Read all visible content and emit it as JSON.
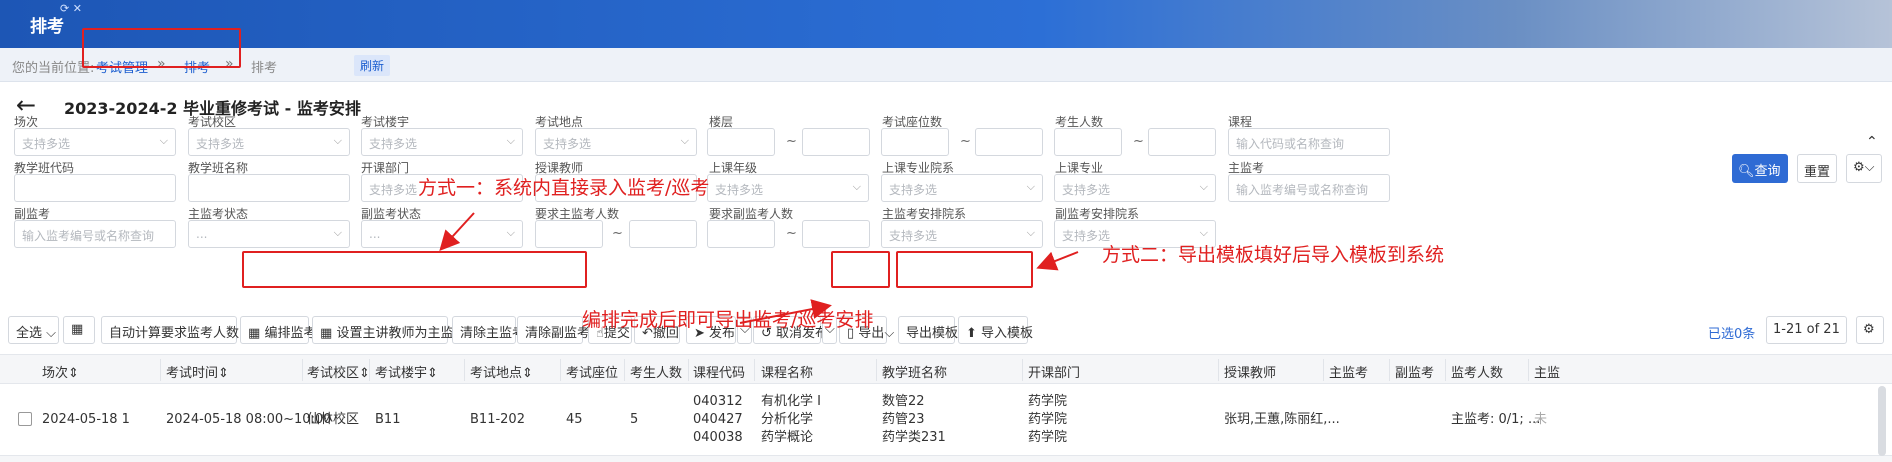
{
  "header": {
    "title": "排考",
    "tab_icons": "⟳ ✕"
  },
  "breadcrumb": {
    "prefix": "您的当前位置:",
    "items": [
      "考试管理",
      "排考",
      "排考"
    ],
    "separator": "»",
    "refresh": "刷新"
  },
  "page": {
    "back_arrow": "←",
    "title": "2023-2024-2 毕业重修考试 - 监考安排"
  },
  "filters": {
    "row1": [
      {
        "label": "场次",
        "placeholder": "支持多选"
      },
      {
        "label": "考试校区",
        "placeholder": "支持多选"
      },
      {
        "label": "考试楼宇",
        "placeholder": "支持多选"
      },
      {
        "label": "考试地点",
        "placeholder": "支持多选"
      },
      {
        "label": "楼层",
        "placeholder": ""
      },
      {
        "label": "考试座位数",
        "placeholder": ""
      },
      {
        "label": "考生人数",
        "placeholder": ""
      },
      {
        "label": "课程",
        "placeholder": "输入代码或名称查询"
      }
    ],
    "row2": [
      {
        "label": "教学班代码",
        "placeholder": ""
      },
      {
        "label": "教学班名称",
        "placeholder": ""
      },
      {
        "label": "开课部门",
        "placeholder": "支持多选"
      },
      {
        "label": "授课教师",
        "placeholder": ""
      },
      {
        "label": "上课年级",
        "placeholder": "支持多选"
      },
      {
        "label": "上课专业院系",
        "placeholder": "支持多选"
      },
      {
        "label": "上课专业",
        "placeholder": "支持多选"
      },
      {
        "label": "主监考",
        "placeholder": "输入监考编号或名称查询"
      }
    ],
    "row3": [
      {
        "label": "副监考",
        "placeholder": "输入监考编号或名称查询"
      },
      {
        "label": "主监考状态",
        "placeholder": "..."
      },
      {
        "label": "副监考状态",
        "placeholder": "..."
      },
      {
        "label": "要求主监考人数",
        "placeholder": ""
      },
      {
        "label": "要求副监考人数",
        "placeholder": ""
      },
      {
        "label": "主监考安排院系",
        "placeholder": "支持多选"
      },
      {
        "label": "副监考安排院系",
        "placeholder": "支持多选"
      }
    ],
    "range_sep": "~",
    "query_label": "查询",
    "reset_label": "重置",
    "collapse_icon": "⌃"
  },
  "toolbar": {
    "select_all": "全选",
    "columns_icon": "▦",
    "auto_calc": "自动计算要求监考人数",
    "arrange_invig": "编排监考",
    "set_lecturer": "设置主讲教师为主监考",
    "clear_main": "清除主监考",
    "clear_deputy": "清除副监考",
    "submit": "提交",
    "withdraw": "撤回",
    "publish": "发布",
    "cancel_publish": "取消发布",
    "export": "导出",
    "export_template": "导出模板",
    "import_template": "导入模板",
    "selected": "已选0条",
    "pager": "1-21 of 21"
  },
  "table": {
    "columns": [
      "场次",
      "考试时间",
      "考试校区",
      "考试楼宇",
      "考试地点",
      "考试座位",
      "考生人数",
      "课程代码",
      "课程名称",
      "教学班名称",
      "开课部门",
      "授课教师",
      "主监考",
      "副监考",
      "监考人数",
      "主监"
    ],
    "rows": [
      {
        "session": "2024-05-18 1",
        "time": "2024-05-18 08:00~10:00",
        "campus": "仙林校区",
        "building": "B11",
        "location": "B11-202",
        "seats": "45",
        "examinees": "5",
        "course_codes": [
          "040312",
          "040427",
          "040038"
        ],
        "course_names": [
          "有机化学 I",
          "分析化学",
          "药学概论"
        ],
        "class_names": [
          "数管22",
          "药管23",
          "药学类231"
        ],
        "departments": [
          "药学院",
          "药学院",
          "药学院"
        ],
        "teachers": "张玥,王蕙,陈丽红,...",
        "main_invig": "",
        "deputy_invig": "",
        "invig_count": "主监考: 0/1; ...",
        "last": "未"
      }
    ]
  },
  "annotations": {
    "method1": "方式一：系统内直接录入监考/巡考",
    "method2": "方式二：导出模板填好后导入模板到系统",
    "export_note": "编排完成后即可导出监考/巡考安排"
  },
  "colors": {
    "header_blue": "#1d56b5",
    "accent_blue": "#2f6bd4",
    "annotation_red": "#e02020"
  }
}
